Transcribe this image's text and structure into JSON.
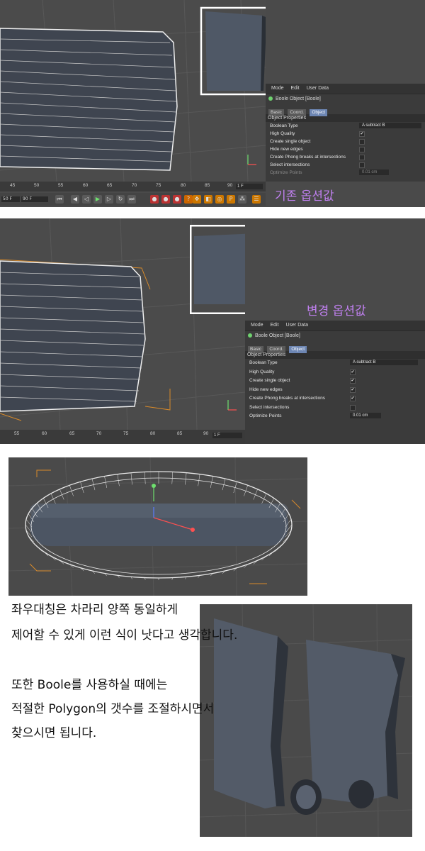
{
  "top": {
    "menu": [
      "Mode",
      "Edit",
      "User Data"
    ],
    "object_title": "Boole Object [Boole]",
    "tabs": [
      "Basic",
      "Coord.",
      "Object"
    ],
    "section": "Object Properties",
    "props": [
      {
        "label": "Boolean Type",
        "value": "A subtract B"
      },
      {
        "label": "High Quality",
        "value": "✔"
      },
      {
        "label": "Create single object",
        "value": ""
      },
      {
        "label": "Hide new edges",
        "value": ""
      },
      {
        "label": "Create Phong breaks at intersections",
        "value": ""
      },
      {
        "label": "Select intersections",
        "value": ""
      },
      {
        "label": "Optimize Points",
        "value": "0.01 cm"
      }
    ],
    "ruler_ticks": [
      "45",
      "50",
      "55",
      "60",
      "65",
      "70",
      "75",
      "80",
      "85",
      "90"
    ],
    "frame_indicator": "1 F",
    "frame_start": "50 F",
    "frame_end": "90 F",
    "caption": "기존 옵션값"
  },
  "middle": {
    "menu": [
      "Mode",
      "Edit",
      "User Data"
    ],
    "object_title": "Boole Object [Boole]",
    "tabs": [
      "Basic",
      "Coord.",
      "Object"
    ],
    "section": "Object Properties",
    "props": [
      {
        "label": "Boolean Type",
        "value": "A subtract B"
      },
      {
        "label": "High Quality",
        "value": "✔"
      },
      {
        "label": "Create single object",
        "value": "✔"
      },
      {
        "label": "Hide new edges",
        "value": "✔"
      },
      {
        "label": "Create Phong breaks at intersections",
        "value": "✔"
      },
      {
        "label": "Select intersections",
        "value": ""
      },
      {
        "label": "Optimize Points",
        "value": "0.01 cm"
      }
    ],
    "ruler_ticks": [
      "55",
      "60",
      "65",
      "70",
      "75",
      "80",
      "85",
      "90"
    ],
    "frame_indicator": "1 F",
    "caption": "변경 옵션값"
  },
  "text_lines": [
    "좌우대칭은 차라리 양쪽 동일하게",
    "제어할 수 있게 이런 식이 낫다고 생각합니다.",
    "",
    "또한 Boole를 사용하실 때에는",
    "적절한 Polygon의 갯수를 조절하시면서",
    "찾으시면 됩니다."
  ],
  "colors": {
    "caption": "#c080f0",
    "viewport_bg": "#4a4a4a",
    "panel_bg": "#3b3b3b",
    "active_tab": "#6d86b3",
    "highlight_frame": "#ffffff"
  }
}
